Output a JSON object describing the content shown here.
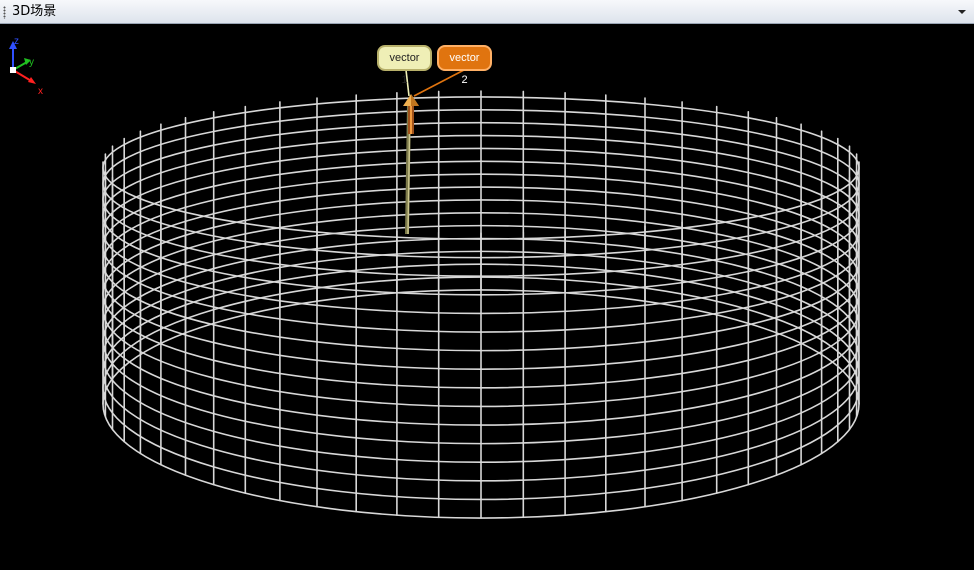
{
  "window": {
    "title": "3D场景"
  },
  "viewport": {
    "background_color": "#000000",
    "wireframe": {
      "shape": "cylinder",
      "color": "#d8d8d8"
    },
    "axis_gizmo": {
      "x_label": "x",
      "y_label": "y",
      "z_label": "z",
      "x_color": "#ff2020",
      "y_color": "#20c020",
      "z_color": "#3050ff"
    },
    "vectors": [
      {
        "label": "vector 1",
        "color": "#efefb6"
      },
      {
        "label": "vector 2",
        "color": "#e0740f"
      }
    ]
  }
}
